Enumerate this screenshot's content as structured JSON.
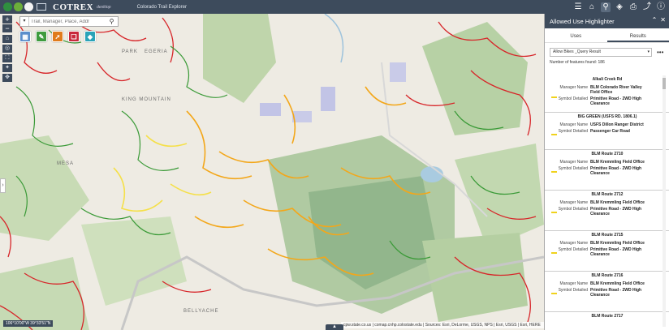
{
  "header": {
    "brand": "COTREX",
    "edition": "desktop",
    "subtitle": "Colorado Trail Explorer",
    "icons": [
      "list-icon",
      "home-icon",
      "trail-search-icon",
      "layers-icon",
      "print-icon",
      "share-icon",
      "info-icon"
    ]
  },
  "map": {
    "search_placeholder": "Trail, Manager, Place, Addr",
    "zoom_in": "+",
    "zoom_out": "−",
    "coords": "106°10'00\"W 39°33'51\"N",
    "attribution": "cpw.state.co.us | comap.cnhp.colostate.edu | Sources: Esri, DeLorme, USGS, NPS | Esri, USGS | Esri, HERE",
    "labels": [
      "PARK",
      "EGERIA",
      "KING MOUNTAIN",
      "MESA",
      "BELLYACHE"
    ]
  },
  "panel": {
    "title": "Allowed Use Highlighter",
    "tabs": [
      "Uses",
      "Results"
    ],
    "active_tab": "Results",
    "layer_select": "Allow Bikes _Query Result",
    "feature_count": "Number of features found: 186",
    "results": [
      {
        "title": "Alkali Creek Rd",
        "manager": "BLM Colorado River Valley Field Office",
        "symbol": "Primitive Road - 2WD High Clearance"
      },
      {
        "title": "BIG GREEN (USFS RD. 1806.1)",
        "manager": "USFS Dillon Ranger District",
        "symbol": "Passenger Car Road"
      },
      {
        "title": "BLM Route 2710",
        "manager": "BLM Kremmling Field Office",
        "symbol": "Primitive Road - 2WD High Clearance"
      },
      {
        "title": "BLM Route 2712",
        "manager": "BLM Kremmling Field Office",
        "symbol": "Primitive Road - 2WD High Clearance"
      },
      {
        "title": "BLM Route 2715",
        "manager": "BLM Kremmling Field Office",
        "symbol": "Primitive Road - 2WD High Clearance"
      },
      {
        "title": "BLM Route 2716",
        "manager": "BLM Kremmling Field Office",
        "symbol": "Primitive Road - 2WD High Clearance"
      },
      {
        "title": "BLM Route 2717",
        "manager": "",
        "symbol": ""
      }
    ],
    "field_labels": {
      "manager": "Manager Name",
      "symbol": "Symbol Detailed"
    }
  }
}
